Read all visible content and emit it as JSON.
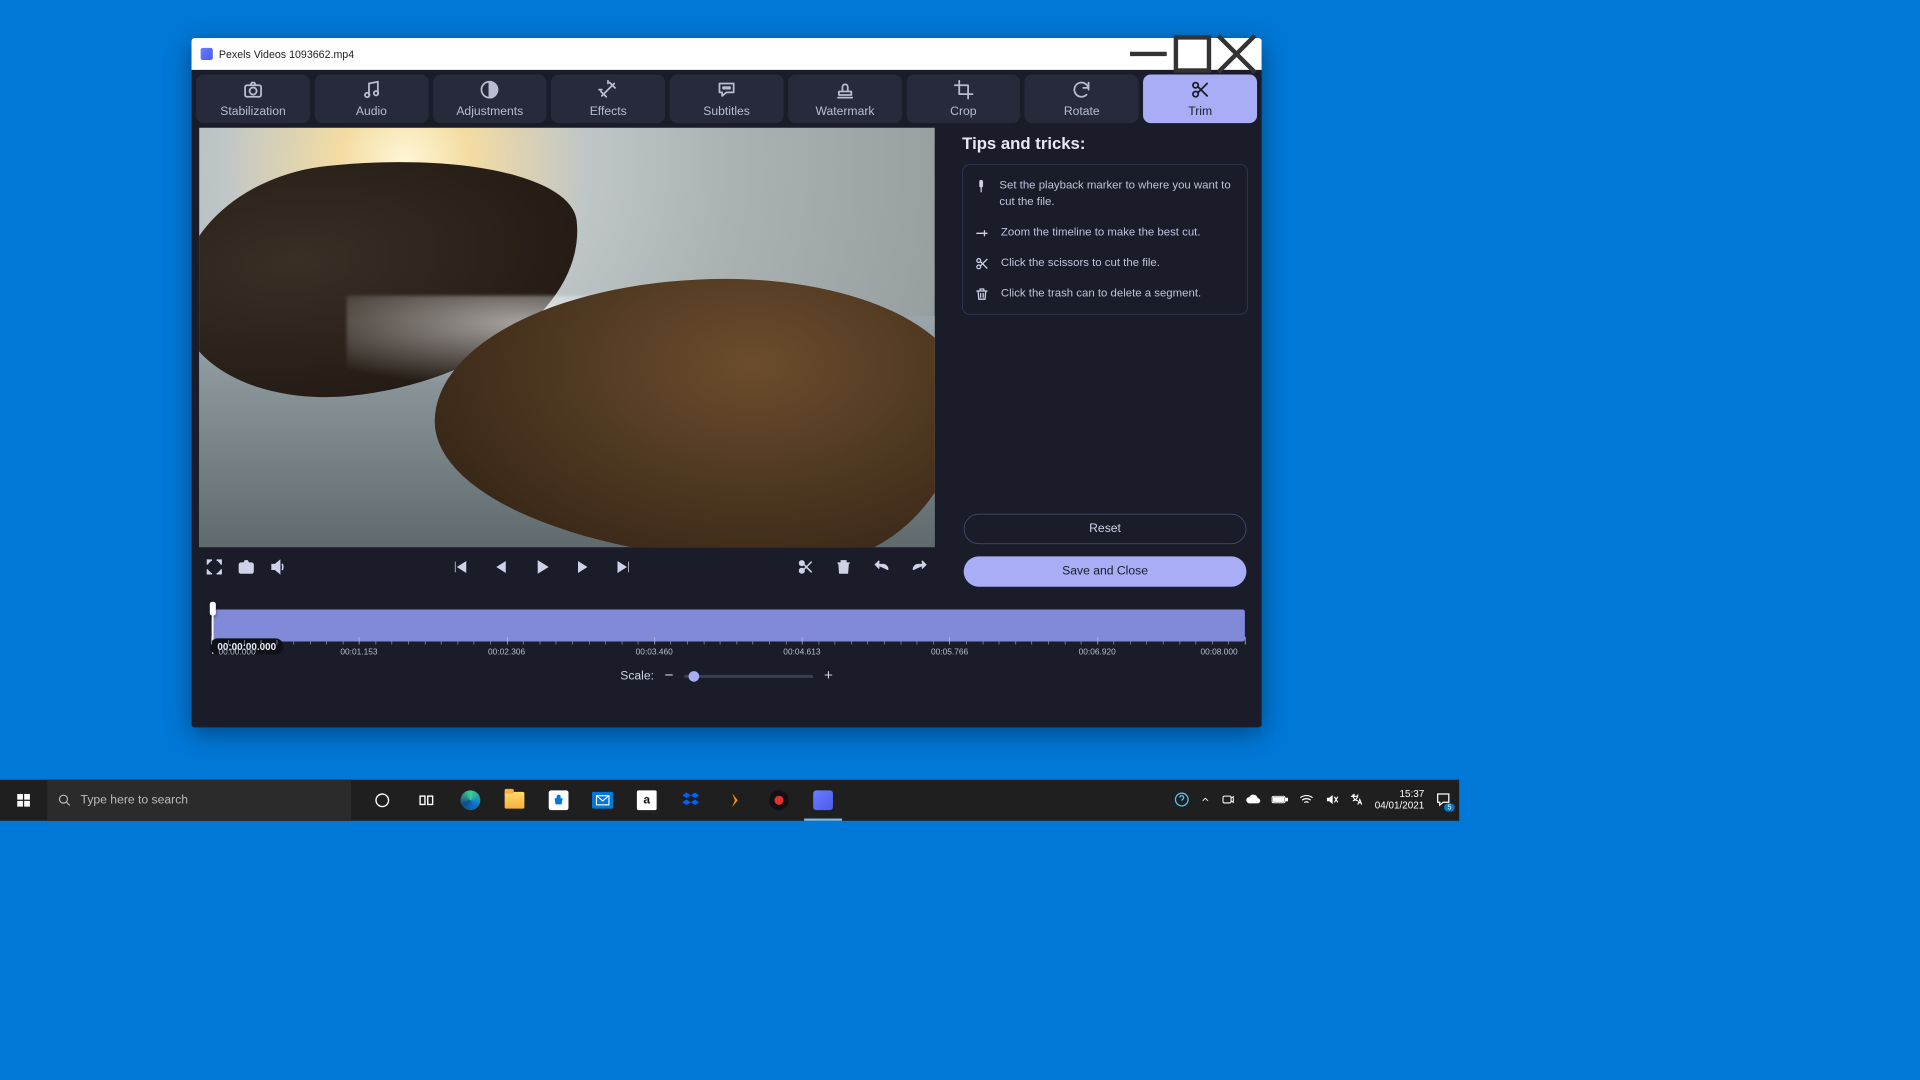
{
  "window": {
    "title": "Pexels Videos 1093662.mp4"
  },
  "toolbar": {
    "items": [
      {
        "id": "stabilization",
        "label": "Stabilization",
        "icon": "camera"
      },
      {
        "id": "audio",
        "label": "Audio",
        "icon": "music-note"
      },
      {
        "id": "adjustments",
        "label": "Adjustments",
        "icon": "contrast"
      },
      {
        "id": "effects",
        "label": "Effects",
        "icon": "wand"
      },
      {
        "id": "subtitles",
        "label": "Subtitles",
        "icon": "speech"
      },
      {
        "id": "watermark",
        "label": "Watermark",
        "icon": "stamp"
      },
      {
        "id": "crop",
        "label": "Crop",
        "icon": "crop"
      },
      {
        "id": "rotate",
        "label": "Rotate",
        "icon": "rotate"
      },
      {
        "id": "trim",
        "label": "Trim",
        "icon": "scissors",
        "active": true
      }
    ]
  },
  "tips": {
    "heading": "Tips and tricks:",
    "items": [
      {
        "icon": "marker",
        "text": "Set the playback marker to where you want to cut the file."
      },
      {
        "icon": "zoom",
        "text": "Zoom the timeline to make the best cut."
      },
      {
        "icon": "scissors",
        "text": "Click the scissors to cut the file."
      },
      {
        "icon": "trash",
        "text": "Click the trash can to delete a segment."
      }
    ]
  },
  "timeline": {
    "timecode": "00:00:00.000",
    "labels": [
      "00:00.000",
      "00:01.153",
      "00:02.306",
      "00:03.460",
      "00:04.613",
      "00:05.766",
      "00:06.920",
      "00:08.000"
    ],
    "scale_label": "Scale:"
  },
  "buttons": {
    "reset": "Reset",
    "save": "Save and Close"
  },
  "taskbar": {
    "search_placeholder": "Type here to search",
    "time": "15:37",
    "date": "04/01/2021",
    "notif_count": "5"
  },
  "colors": {
    "accent": "#a8adf5",
    "panel": "#262a3b",
    "bg": "#1a1d29"
  }
}
